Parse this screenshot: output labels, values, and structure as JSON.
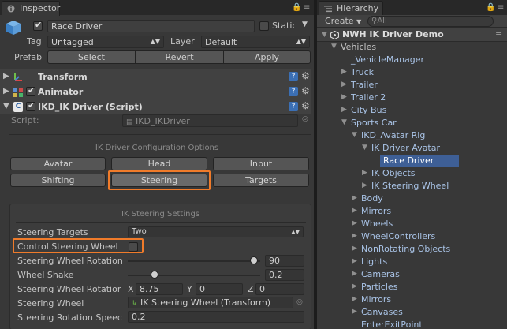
{
  "inspector": {
    "tab_label": "Inspector",
    "object_name": "Race Driver",
    "static_label": "Static",
    "tag_label": "Tag",
    "tag_value": "Untagged",
    "layer_label": "Layer",
    "layer_value": "Default",
    "prefab_label": "Prefab",
    "prefab_buttons": [
      "Select",
      "Revert",
      "Apply"
    ],
    "components": [
      "Transform",
      "Animator",
      "IKD_IK Driver (Script)"
    ],
    "script_label": "Script:",
    "script_value": "IKD_IKDriver",
    "config_heading": "IK Driver Configuration Options",
    "config_buttons": [
      "Avatar",
      "Head",
      "Input",
      "Shifting",
      "Steering",
      "Targets"
    ],
    "steering_heading": "IK Steering Settings",
    "fields": {
      "steering_targets_label": "Steering Targets",
      "steering_targets_value": "Two",
      "control_wheel_label": "Control Steering Wheel",
      "wheel_rotation_label": "Steering Wheel Rotation",
      "wheel_rotation_value": "90",
      "wheel_shake_label": "Wheel Shake",
      "wheel_shake_value": "0.2",
      "wheel_rot_vec_label": "Steering Wheel Rotatior",
      "x_label": "X",
      "x_value": "8.75",
      "y_label": "Y",
      "y_value": "0",
      "z_label": "Z",
      "z_value": "0",
      "steering_wheel_label": "Steering Wheel",
      "steering_wheel_value": "IK Steering Wheel (Transform)",
      "rotation_speed_label": "Steering Rotation Speec",
      "rotation_speed_value": "0.2"
    },
    "wheel_rotation_fraction": 0.95,
    "wheel_shake_fraction": 0.2
  },
  "hierarchy": {
    "tab_label": "Hierarchy",
    "create_label": "Create",
    "search_placeholder": "All",
    "scene_title": "NWH IK Driver Demo",
    "items": [
      {
        "label": "Vehicles",
        "grey": true
      },
      {
        "label": "_VehicleManager"
      },
      {
        "label": "Truck"
      },
      {
        "label": "Trailer"
      },
      {
        "label": "Trailer 2"
      },
      {
        "label": "City Bus"
      },
      {
        "label": "Sports Car"
      },
      {
        "label": "IKD_Avatar Rig"
      },
      {
        "label": "IK Driver Avatar"
      },
      {
        "label": "Race Driver",
        "selected": true
      },
      {
        "label": "IK Objects"
      },
      {
        "label": "IK Steering Wheel"
      },
      {
        "label": "Body"
      },
      {
        "label": "Mirrors"
      },
      {
        "label": "Wheels"
      },
      {
        "label": "WheelControllers"
      },
      {
        "label": "NonRotating Objects"
      },
      {
        "label": "Lights"
      },
      {
        "label": "Cameras"
      },
      {
        "label": "Particles"
      },
      {
        "label": "Mirrors"
      },
      {
        "label": "Canvases"
      },
      {
        "label": "EnterExitPoint"
      }
    ]
  }
}
